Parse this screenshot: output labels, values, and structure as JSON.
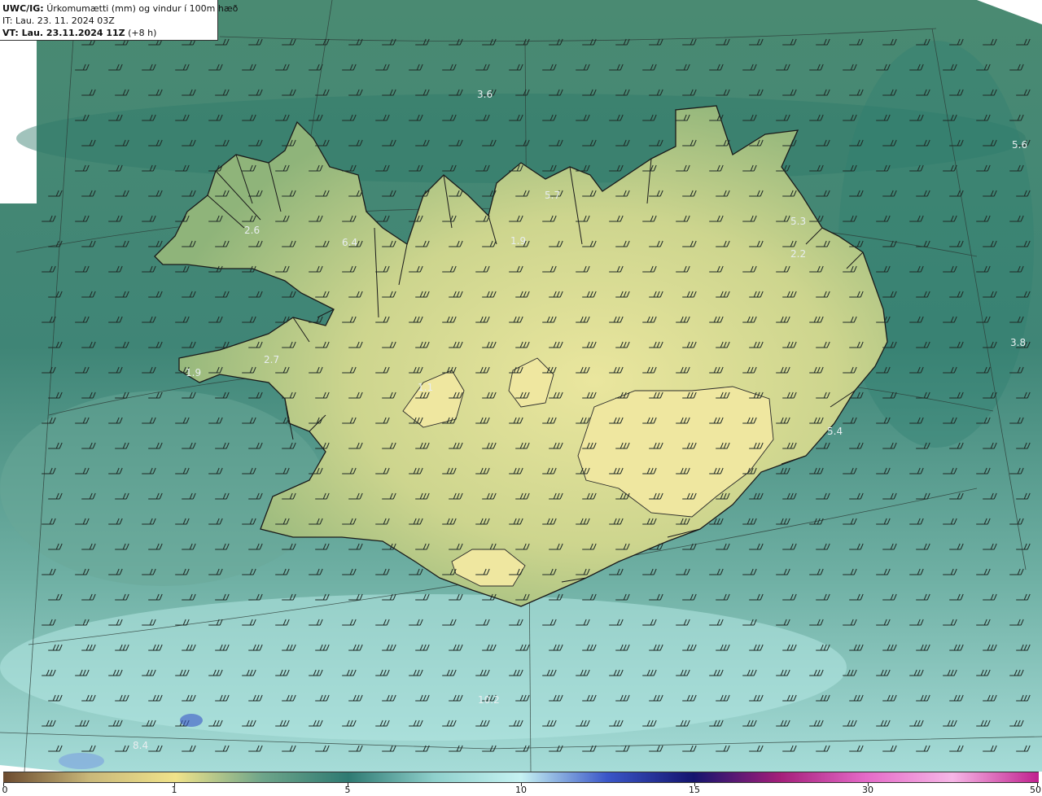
{
  "header": {
    "model": "UWC/IG:",
    "title": "Úrkomumætti (mm) og vindur í 100m hæð",
    "it_line": "IT: Lau. 23. 11. 2024 03Z",
    "vt_label": "VT: Lau. 23.11.2024 11Z",
    "vt_offset": "(+8 h)"
  },
  "value_labels": [
    "3.6",
    "5.6",
    "5.7",
    "5.3",
    "2.2",
    "2.6",
    "6.4",
    "1.9",
    "3.8",
    "2.7",
    "1.9",
    "1.1",
    "5.4",
    "10.2",
    "8.4"
  ],
  "colorbar": {
    "tick_labels": [
      "0",
      "1",
      "5",
      "10",
      "15",
      "30",
      "50"
    ],
    "tick_values": [
      0,
      1,
      5,
      10,
      15,
      30,
      50
    ],
    "colors": [
      "#6b4a2e",
      "#c9b87a",
      "#f0e38a",
      "#6ea58a",
      "#2e7a72",
      "#8fd0cc",
      "#c6f2f2",
      "#3a56c8",
      "#14146e",
      "#a41e7a",
      "#e56ac8",
      "#f6b6e6",
      "#c0208e"
    ]
  },
  "map_colors": {
    "ocean_base": "#4f8c7a",
    "ocean_light": "#a8e2e0",
    "land_low": "#8cb47a",
    "land_high": "#e6e49a",
    "coast": "#1a1a1a",
    "barb": "#222222"
  }
}
